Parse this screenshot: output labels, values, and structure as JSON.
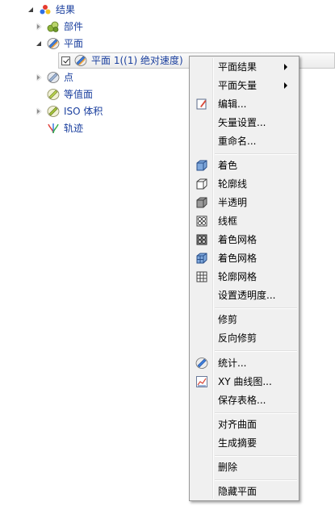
{
  "tree": {
    "root": {
      "label": "结果",
      "icon": "results-icon"
    },
    "items": [
      {
        "label": "部件",
        "icon": "parts-icon",
        "expander": "closed"
      },
      {
        "label": "平面",
        "icon": "plane-icon",
        "expander": "open"
      },
      {
        "label": "平面 1((1) 绝对速度)",
        "icon": "plane-icon",
        "checked": true
      },
      {
        "label": "点",
        "icon": "point-icon",
        "expander": "closed"
      },
      {
        "label": "等值面",
        "icon": "isosurface-icon"
      },
      {
        "label": "ISO 体积",
        "icon": "iso-volume-icon",
        "expander": "closed"
      },
      {
        "label": "轨迹",
        "icon": "streamline-icon"
      }
    ]
  },
  "menu": {
    "items": [
      {
        "label": "平面结果",
        "submenu": true
      },
      {
        "label": "平面矢量",
        "submenu": true
      },
      {
        "label": "编辑...",
        "icon": "edit-icon"
      },
      {
        "label": "矢量设置..."
      },
      {
        "label": "重命名..."
      },
      {
        "label": "着色",
        "icon": "shaded-cube-icon"
      },
      {
        "label": "轮廓线",
        "icon": "outline-cube-icon"
      },
      {
        "label": "半透明",
        "icon": "translucent-cube-icon"
      },
      {
        "label": "线框",
        "icon": "wireframe-cube-icon"
      },
      {
        "label": "着色网格",
        "icon": "shaded-mesh-icon"
      },
      {
        "label": "着色网格",
        "icon": "shaded-mesh-2-icon"
      },
      {
        "label": "轮廓网格",
        "icon": "outline-mesh-icon"
      },
      {
        "label": "设置透明度..."
      },
      {
        "label": "修剪"
      },
      {
        "label": "反向修剪"
      },
      {
        "label": "统计...",
        "icon": "statistics-icon"
      },
      {
        "label": "XY 曲线图...",
        "icon": "xy-plot-icon"
      },
      {
        "label": "保存表格..."
      },
      {
        "label": "对齐曲面"
      },
      {
        "label": "生成摘要"
      },
      {
        "label": "删除"
      },
      {
        "label": "隐藏平面"
      }
    ]
  },
  "colors": {
    "tree_text": "#1a3f9e",
    "menu_bg": "#f0f0f0",
    "menu_border": "#979797"
  }
}
